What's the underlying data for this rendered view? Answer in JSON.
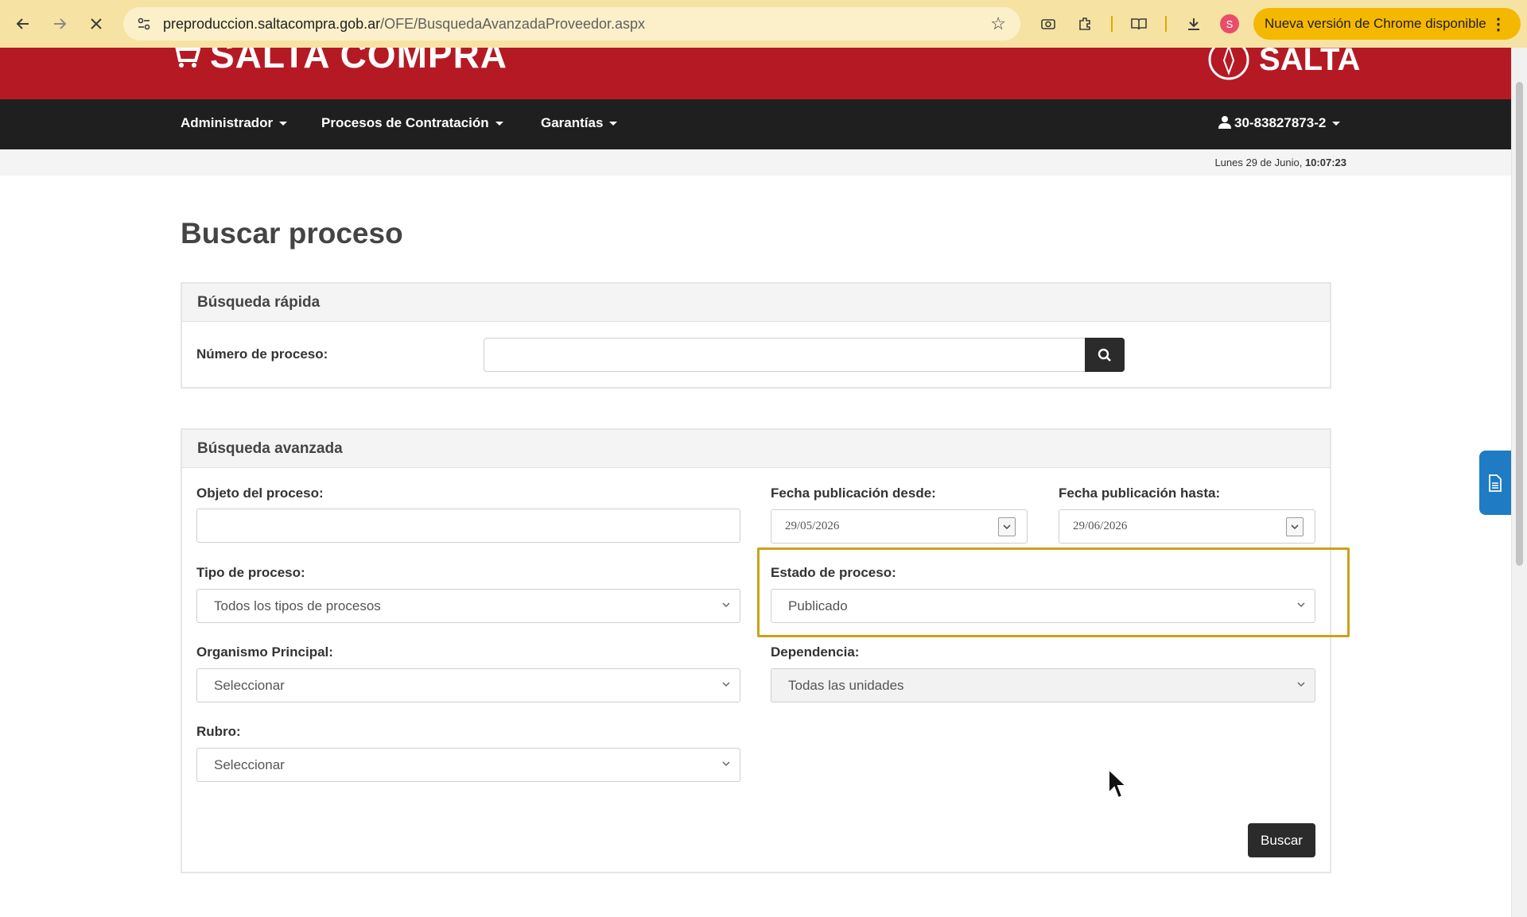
{
  "browser": {
    "url_host": "preproduccion.saltacompra.gob.ar",
    "url_path": "/OFE/BusquedaAvanzadaProveedor.aspx",
    "profile_initial": "S",
    "update_label": "Nueva versión de Chrome disponible",
    "accent_color": "#f5b800"
  },
  "site": {
    "brand_left": "SALTA COMPRA",
    "brand_right": "SALTA",
    "brand_color": "#b51a24",
    "menu": {
      "admin": "Administrador",
      "procesos": "Procesos de Contratación",
      "garantias": "Garantías",
      "user": "30-83827873-2"
    },
    "date_prefix": "Lunes 29 de Junio,",
    "time": "10:07:23"
  },
  "page": {
    "title": "Buscar proceso",
    "quick": {
      "heading": "Búsqueda rápida",
      "numero_label": "Número de proceso:",
      "numero_value": ""
    },
    "advanced": {
      "heading": "Búsqueda avanzada",
      "objeto_label": "Objeto del proceso:",
      "objeto_value": "",
      "fecha_desde_label": "Fecha publicación desde:",
      "fecha_desde_value": "29/05/2026",
      "fecha_hasta_label": "Fecha publicación hasta:",
      "fecha_hasta_value": "29/06/2026",
      "tipo_label": "Tipo de proceso:",
      "tipo_value": "Todos los tipos de procesos",
      "estado_label": "Estado de proceso:",
      "estado_value": "Publicado",
      "organismo_label": "Organismo Principal:",
      "organismo_value": "Seleccionar",
      "dependencia_label": "Dependencia:",
      "dependencia_value": "Todas las unidades",
      "rubro_label": "Rubro:",
      "rubro_value": "Seleccionar",
      "buscar_label": "Buscar"
    }
  }
}
